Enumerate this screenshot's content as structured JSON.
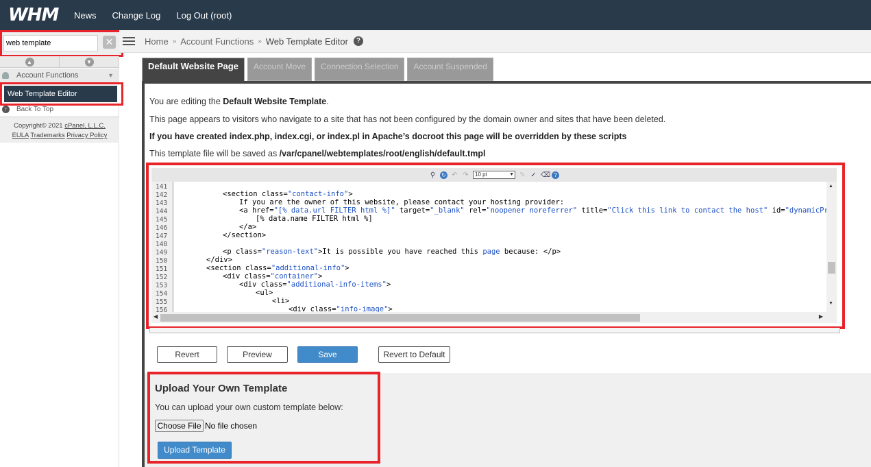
{
  "topbar": {
    "logo": "WHM",
    "nav": [
      "News",
      "Change Log",
      "Log Out (root)"
    ]
  },
  "sidebar": {
    "search_value": "web template",
    "category": "Account Functions",
    "active_item": "Web Template Editor",
    "back_to_top": "Back To Top",
    "copyright": "Copyright© 2021",
    "company": "cPanel, L.L.C.",
    "links": [
      "EULA",
      "Trademarks",
      "Privacy Policy"
    ]
  },
  "breadcrumb": {
    "home": "Home",
    "section": "Account Functions",
    "current": "Web Template Editor"
  },
  "tabs": [
    "Default Website Page",
    "Account Move",
    "Connection Selection",
    "Account Suspended"
  ],
  "main": {
    "editing_prefix": "You are editing the ",
    "editing_name": "Default Website Template",
    "editing_suffix": ".",
    "appears_text": "This page appears to visitors who navigate to a site that has not been configured by the domain owner and sites that have been deleted.",
    "override_text": "If you have created index.php, index.cgi, or index.pl in Apache’s docroot this page will be overridden by these scripts",
    "saved_prefix": "This template file will be saved as ",
    "saved_path": "/var/cpanel/webtemplates/root/english/default.tmpl"
  },
  "editor": {
    "font_size": "10 pt",
    "line_numbers": [
      "141",
      "142",
      "143",
      "144",
      "145",
      "146",
      "147",
      "148",
      "149",
      "150",
      "151",
      "152",
      "153",
      "154",
      "155",
      "156"
    ]
  },
  "buttons": {
    "revert": "Revert",
    "preview": "Preview",
    "save": "Save",
    "revert_default": "Revert to Default"
  },
  "upload": {
    "title": "Upload Your Own Template",
    "description": "You can upload your own custom template below:",
    "choose_file": "Choose File",
    "no_file": "No file chosen",
    "upload_button": "Upload Template"
  },
  "colors": {
    "topbar": "#293a4a",
    "highlight": "#e8232a",
    "primary": "#428bca",
    "code_string": "#1a4fc4"
  }
}
